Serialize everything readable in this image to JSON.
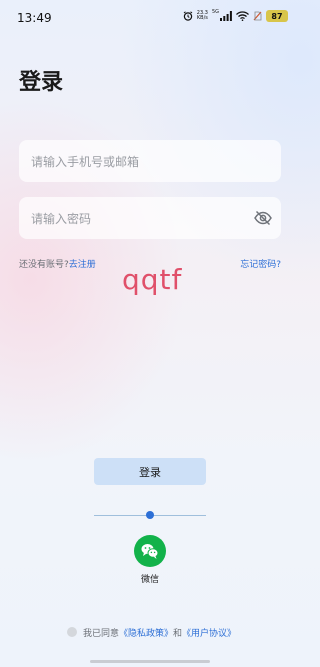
{
  "status_bar": {
    "time": "13:49",
    "net_speed_value": "23.3",
    "net_speed_unit": "KB/s",
    "network_label": "5G",
    "battery": "87",
    "icons": [
      "alarm-icon",
      "cellular-signal-icon",
      "wifi-icon",
      "no-sim-icon",
      "battery-icon"
    ]
  },
  "page": {
    "title": "登录"
  },
  "form": {
    "phone_placeholder": "请输入手机号或邮箱",
    "password_placeholder": "请输入密码",
    "password_visibility_icon": "eye-off-icon"
  },
  "links": {
    "no_account": "还没有账号?",
    "register": "去注册",
    "forgot_password": "忘记密码?"
  },
  "watermark_text": "qqtf",
  "login_button": "登录",
  "third_party": {
    "wechat_icon": "wechat-icon",
    "wechat_label": "微信"
  },
  "agreement": {
    "prefix": "我已同意",
    "privacy": "《隐私政策》",
    "and": "和",
    "terms": "《用户协议》"
  },
  "colors": {
    "accent": "#2d6fd6",
    "login_button_bg": "#cde0f7",
    "wechat_green": "#12b24a",
    "watermark": "#e0506a"
  }
}
